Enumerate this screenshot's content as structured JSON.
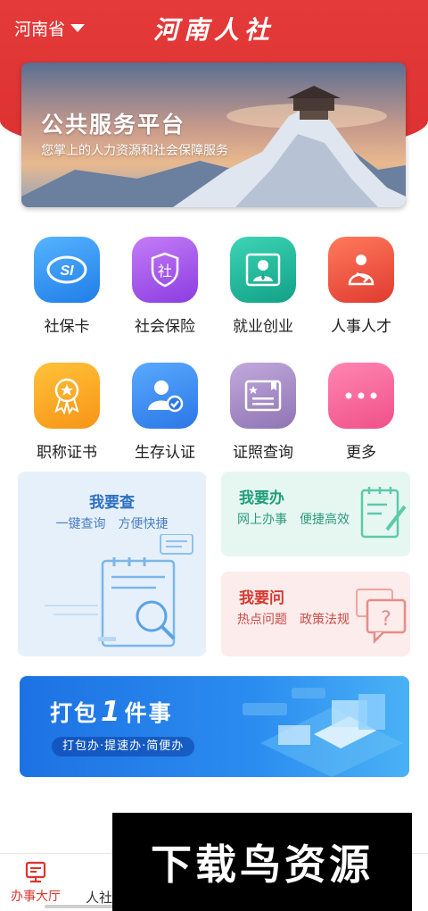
{
  "header": {
    "province": "河南省",
    "title": "河南人社"
  },
  "banner": {
    "title": "公共服务平台",
    "subtitle": "您掌上的人力资源和社会保障服务"
  },
  "services": [
    {
      "label": "社保卡",
      "icon": "social-security-card-icon",
      "color": "#2b8cf0"
    },
    {
      "label": "社会保险",
      "icon": "shield-she-icon",
      "color": "#9b4de8"
    },
    {
      "label": "就业创业",
      "icon": "businessman-icon",
      "color": "#1fb59a"
    },
    {
      "label": "人事人才",
      "icon": "person-sling-icon",
      "color": "#ef4a3b"
    },
    {
      "label": "职称证书",
      "icon": "star-medal-icon",
      "color": "#f7a21b"
    },
    {
      "label": "生存认证",
      "icon": "user-verified-icon",
      "color": "#3a8ff0"
    },
    {
      "label": "证照查询",
      "icon": "certificate-icon",
      "color": "#a38ac0"
    },
    {
      "label": "更多",
      "icon": "more-dots-icon",
      "color": "#f25f93"
    }
  ],
  "cards": {
    "query": {
      "title": "我要查",
      "subtitle": "一键查询　方便快捷"
    },
    "do": {
      "title": "我要办",
      "subtitle": "网上办事　便捷高效"
    },
    "ask": {
      "title": "我要问",
      "subtitle": "热点问题　政策法规"
    }
  },
  "pack": {
    "title_pre": "打包",
    "title_num": "1",
    "title_post": "件事",
    "subtitle": "打包办·提速办·简便办"
  },
  "tabbar": {
    "home_label": "办事大厅",
    "news_label": "人社"
  },
  "watermark": "下载鸟资源"
}
